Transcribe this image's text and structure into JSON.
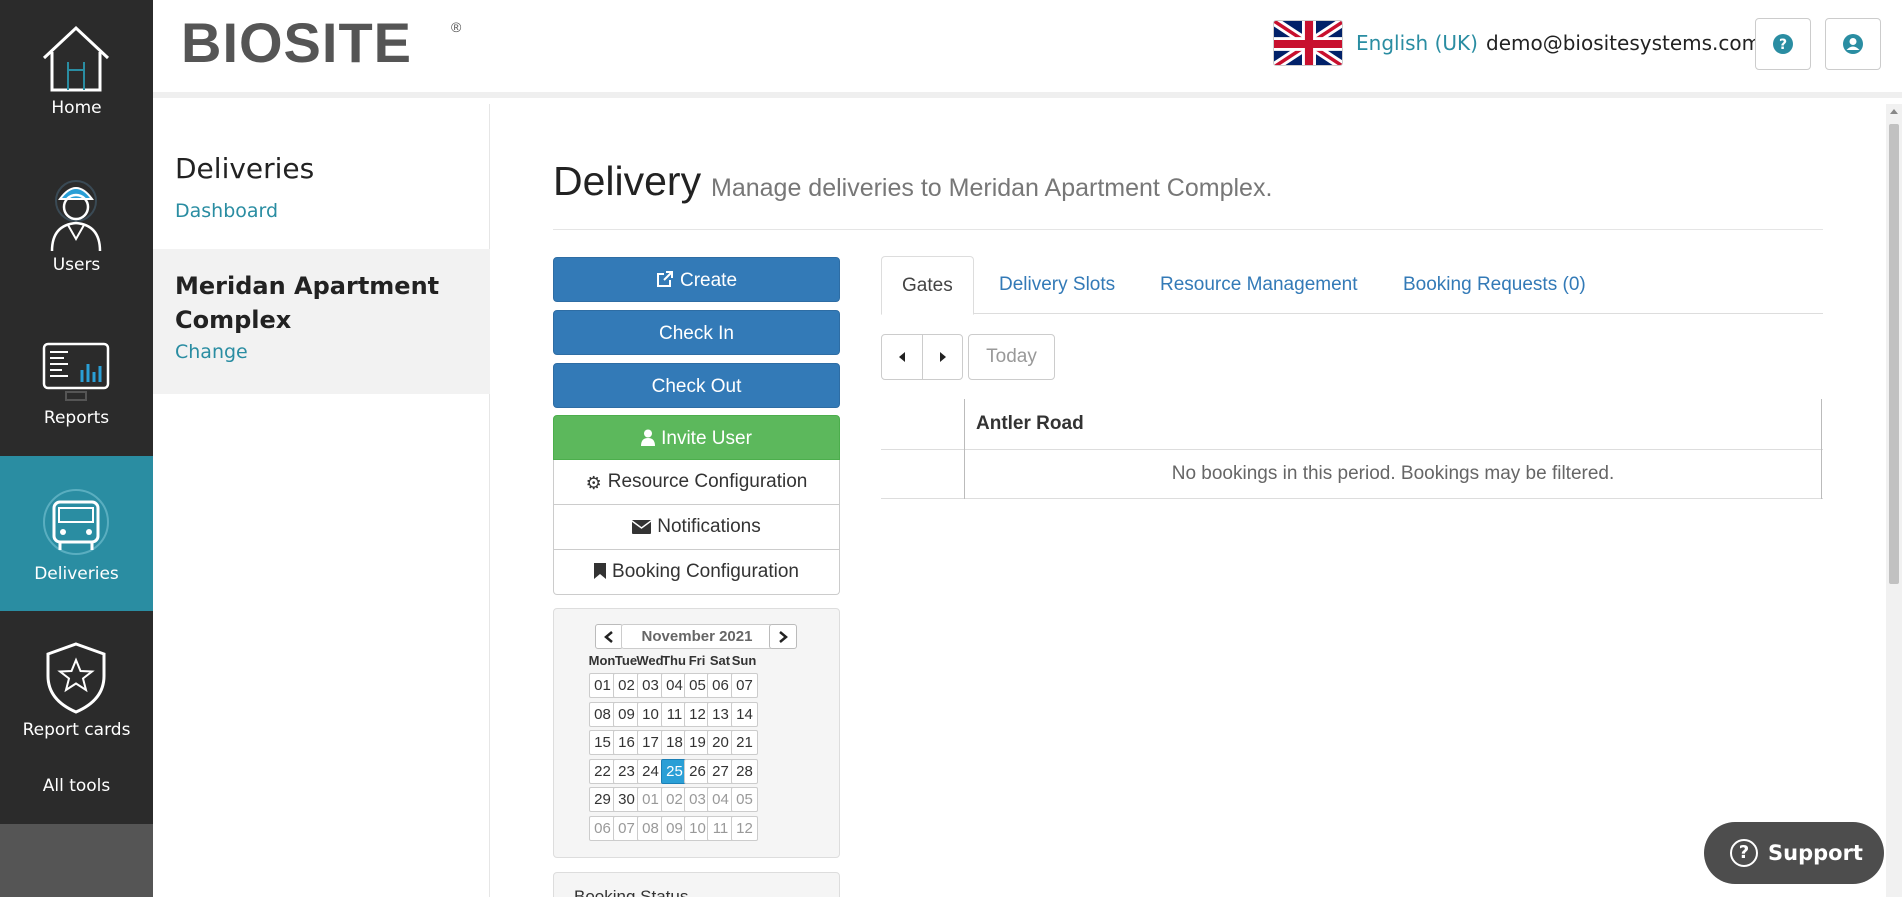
{
  "nav": {
    "items": [
      {
        "label": "Home",
        "icon": "house-icon"
      },
      {
        "label": "Users",
        "icon": "worker-icon"
      },
      {
        "label": "Reports",
        "icon": "report-icon"
      },
      {
        "label": "Deliveries",
        "icon": "truck-icon"
      },
      {
        "label": "Report cards",
        "icon": "shield-star-icon"
      }
    ],
    "all_tools": "All tools"
  },
  "header": {
    "logo_text": "BIOSITE",
    "logo_reg": "®",
    "language": "English (UK)",
    "email": "demo@biositesystems.com"
  },
  "subnav": {
    "section_title": "Deliveries",
    "dashboard_link": "Dashboard",
    "site_name": "Meridan Apartment Complex",
    "site_name_line1": "Meridan Apartment",
    "site_name_line2": "Complex",
    "change_link": "Change"
  },
  "main": {
    "title": "Delivery",
    "subtitle": "Manage deliveries to Meridan Apartment Complex.",
    "actions": {
      "create": "Create",
      "check_in": "Check In",
      "check_out": "Check Out",
      "invite_user": "Invite User",
      "resource_config": "Resource Configuration",
      "notifications": "Notifications",
      "booking_config": "Booking Configuration"
    },
    "booking_status_title": "Booking Status"
  },
  "calendar": {
    "month": "November 2021",
    "weekdays": [
      "Mon",
      "Tue",
      "Wed",
      "Thu",
      "Fri",
      "Sat",
      "Sun"
    ],
    "weeks": [
      [
        "01",
        "02",
        "03",
        "04",
        "05",
        "06",
        "07"
      ],
      [
        "08",
        "09",
        "10",
        "11",
        "12",
        "13",
        "14"
      ],
      [
        "15",
        "16",
        "17",
        "18",
        "19",
        "20",
        "21"
      ],
      [
        "22",
        "23",
        "24",
        "25",
        "26",
        "27",
        "28"
      ],
      [
        "29",
        "30",
        "01",
        "02",
        "03",
        "04",
        "05"
      ],
      [
        "06",
        "07",
        "08",
        "09",
        "10",
        "11",
        "12"
      ]
    ],
    "selected": "25"
  },
  "tabs": [
    {
      "label": "Gates",
      "active": true
    },
    {
      "label": "Delivery Slots",
      "active": false
    },
    {
      "label": "Resource Management",
      "active": false
    },
    {
      "label": "Booking Requests (0)",
      "active": false
    }
  ],
  "toolbar": {
    "today": "Today"
  },
  "gates_table": {
    "gate_name": "Antler Road",
    "empty_message": "No bookings in this period. Bookings may be filtered."
  },
  "support": {
    "label": "Support"
  },
  "colors": {
    "nav_bg": "#2b2b2b",
    "nav_active": "#2a8da2",
    "primary": "#337ab7",
    "success": "#5cb85c",
    "link": "#2a8da2"
  }
}
